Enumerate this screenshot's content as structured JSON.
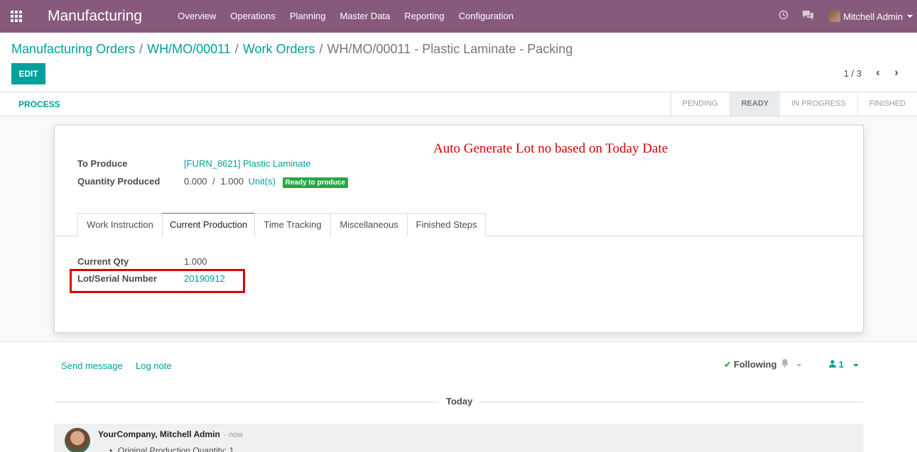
{
  "navbar": {
    "app_name": "Manufacturing",
    "menu": [
      "Overview",
      "Operations",
      "Planning",
      "Master Data",
      "Reporting",
      "Configuration"
    ],
    "user": "Mitchell Admin",
    "icons": [
      "apps-grid-icon",
      "clock-icon",
      "chat-icon"
    ]
  },
  "breadcrumb": {
    "items": [
      "Manufacturing Orders",
      "WH/MO/00011",
      "Work Orders"
    ],
    "current": "WH/MO/00011 - Plastic Laminate - Packing",
    "separator": "/"
  },
  "toolbar": {
    "edit_label": "EDIT"
  },
  "pager": {
    "value": "1 / 3",
    "prev": "‹",
    "next": "›"
  },
  "statusbar": {
    "process_label": "PROCESS",
    "stages": [
      "PENDING",
      "READY",
      "IN PROGRESS",
      "FINISHED"
    ],
    "active_stage": "READY"
  },
  "form": {
    "annotation": "Auto Generate Lot no based on Today Date",
    "to_produce_label": "To Produce",
    "to_produce_value": "[FURN_8621] Plastic Laminate",
    "qty_produced_label": "Quantity Produced",
    "qty_produced_value": "0.000",
    "qty_separator": "/",
    "qty_total": "1.000",
    "uom": "Unit(s)",
    "badge": "Ready to produce",
    "tabs": [
      "Work Instruction",
      "Current Production",
      "Time Tracking",
      "Miscellaneous",
      "Finished Steps"
    ],
    "active_tab": "Current Production",
    "current_qty_label": "Current Qty",
    "current_qty_value": "1.000",
    "lot_label": "Lot/Serial Number",
    "lot_value": "20190912"
  },
  "chatter": {
    "send_message": "Send message",
    "log_note": "Log note",
    "following": "Following",
    "followers_count": "1",
    "day_label": "Today",
    "message": {
      "author": "YourCompany, Mitchell Admin",
      "date": "- now",
      "body": "Original Production Quantity: 1"
    }
  },
  "colors": {
    "navbar": "#875a7b",
    "primary": "#00a09d",
    "badge": "#28a745",
    "annotation": "#d40000",
    "highlight_box": "#e00000"
  }
}
